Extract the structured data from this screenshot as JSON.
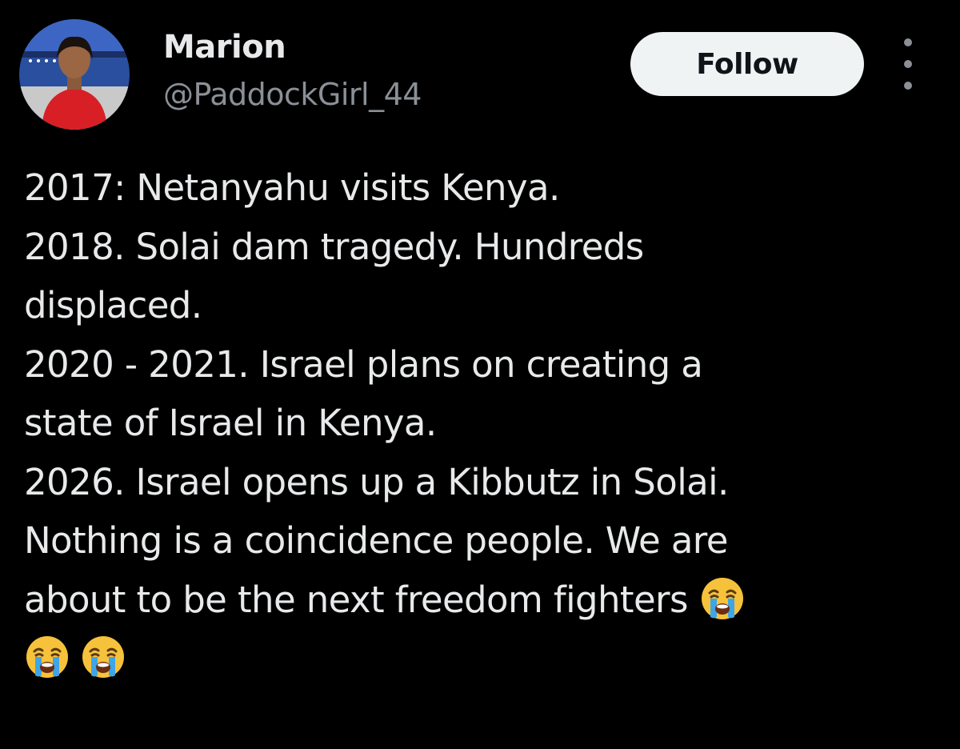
{
  "user": {
    "name": "Marion",
    "handle": "@PaddockGirl_44",
    "avatar_icon": "profile-photo"
  },
  "actions": {
    "follow_label": "Follow",
    "more_icon": "more-options-icon"
  },
  "tweet": {
    "lines": [
      "2017: Netanyahu visits Kenya.",
      "2018. Solai dam tragedy. Hundreds",
      "displaced.",
      "2020 - 2021. Israel plans on creating a",
      "state of Israel in Kenya.",
      "2026. Israel opens up a Kibbutz in Solai.",
      "Nothing is a coincidence people. We are",
      "about to be the next freedom fighters"
    ],
    "trailing_emoji": "loudly-crying-face",
    "emoji_count": 3
  },
  "colors": {
    "background": "#000000",
    "text_primary": "#e7e9ea",
    "text_secondary": "#8b9096",
    "button_bg": "#eff3f4",
    "button_text": "#0f1419"
  }
}
